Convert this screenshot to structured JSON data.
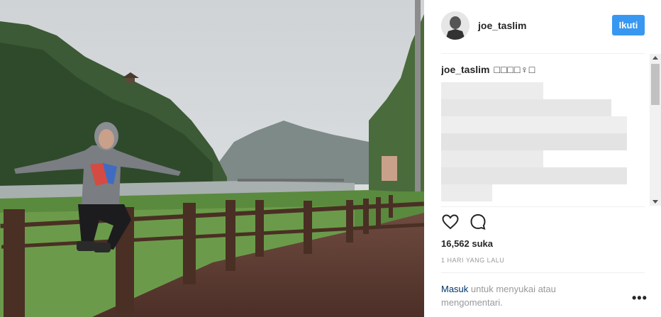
{
  "post": {
    "username": "joe_taslim",
    "follow_label": "Ikuti",
    "caption_user": "joe_taslim",
    "caption_text": "□□□□♀□",
    "likes": "16,562 suka",
    "time": "1 HARI YANG LALU",
    "login_link": "Masuk",
    "login_text": " untuk menyukai atau mengomentari.",
    "more_label": "•••"
  },
  "icons": {
    "like": "heart-icon",
    "comment": "comment-icon",
    "more": "more-options-icon"
  },
  "colors": {
    "follow_button": "#3897f0",
    "link": "#003569"
  }
}
